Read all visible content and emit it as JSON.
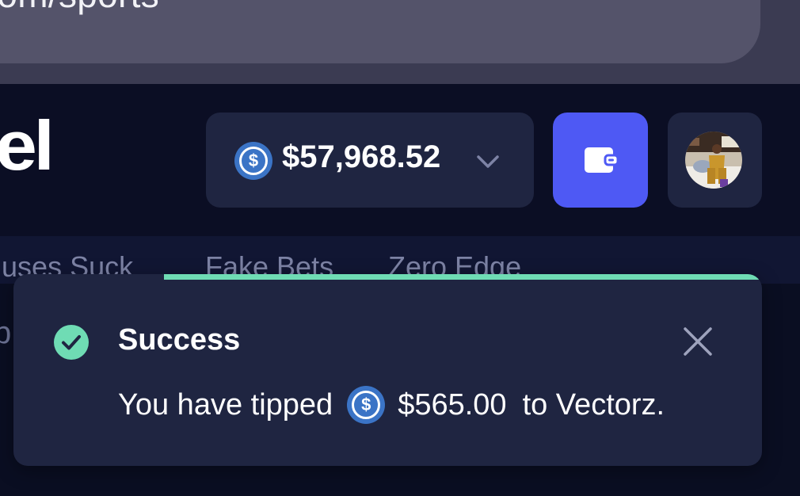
{
  "browser": {
    "url": ".com/sports"
  },
  "header": {
    "logo_fragment": "el",
    "balance": {
      "coin_icon": "usdc-coin-icon",
      "coin_symbol": "$",
      "amount": "$57,968.52",
      "dropdown_icon": "chevron-down-icon"
    },
    "wallet_icon": "wallet-icon",
    "avatar_icon": "user-avatar"
  },
  "nav": {
    "tabs": [
      {
        "label": "nuses Suck"
      },
      {
        "label": "Fake Bets"
      },
      {
        "label": "Zero Edge"
      }
    ],
    "side_fragment": "p"
  },
  "toast": {
    "status_icon": "check-circle-icon",
    "title": "Success",
    "message_prefix": "You have tipped",
    "coin_symbol": "$",
    "amount": "$565.00",
    "message_suffix": "to Vectorz.",
    "close_icon": "close-icon"
  },
  "colors": {
    "accent": "#4e59f4",
    "success": "#6fdcb4",
    "coin": "#3b74c6",
    "panel": "#1f2541",
    "background": "#0a0e22"
  }
}
